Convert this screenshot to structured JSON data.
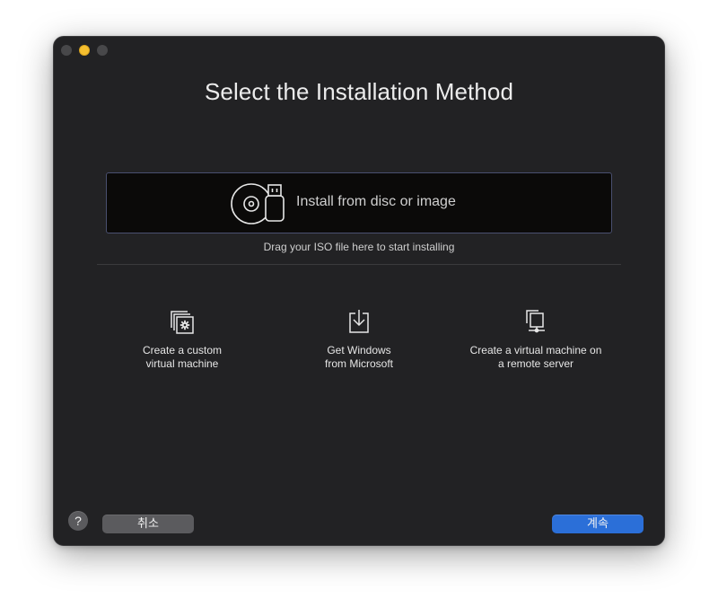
{
  "window": {
    "title": "Select the Installation Method"
  },
  "drop_zone": {
    "label": "Install from disc or image",
    "hint": "Drag your ISO file here to start installing",
    "icon": "disc-usb-icon"
  },
  "options": [
    {
      "line1": "Create a custom",
      "line2": "virtual machine",
      "icon": "custom-vm-gear-icon"
    },
    {
      "line1": "Get Windows",
      "line2": "from Microsoft",
      "icon": "download-icon"
    },
    {
      "line1": "Create a virtual machine on",
      "line2": "a remote server",
      "icon": "remote-server-icon"
    }
  ],
  "footer": {
    "help_label": "?",
    "cancel_label": "취소",
    "continue_label": "계속"
  },
  "colors": {
    "window_bg": "#222224",
    "drop_zone_bg": "#0b0a09",
    "drop_zone_border": "#4a5070",
    "primary_button": "#2b6fd8",
    "secondary_button": "#5b5b5e",
    "minimize_yellow": "#f5bf2f"
  }
}
